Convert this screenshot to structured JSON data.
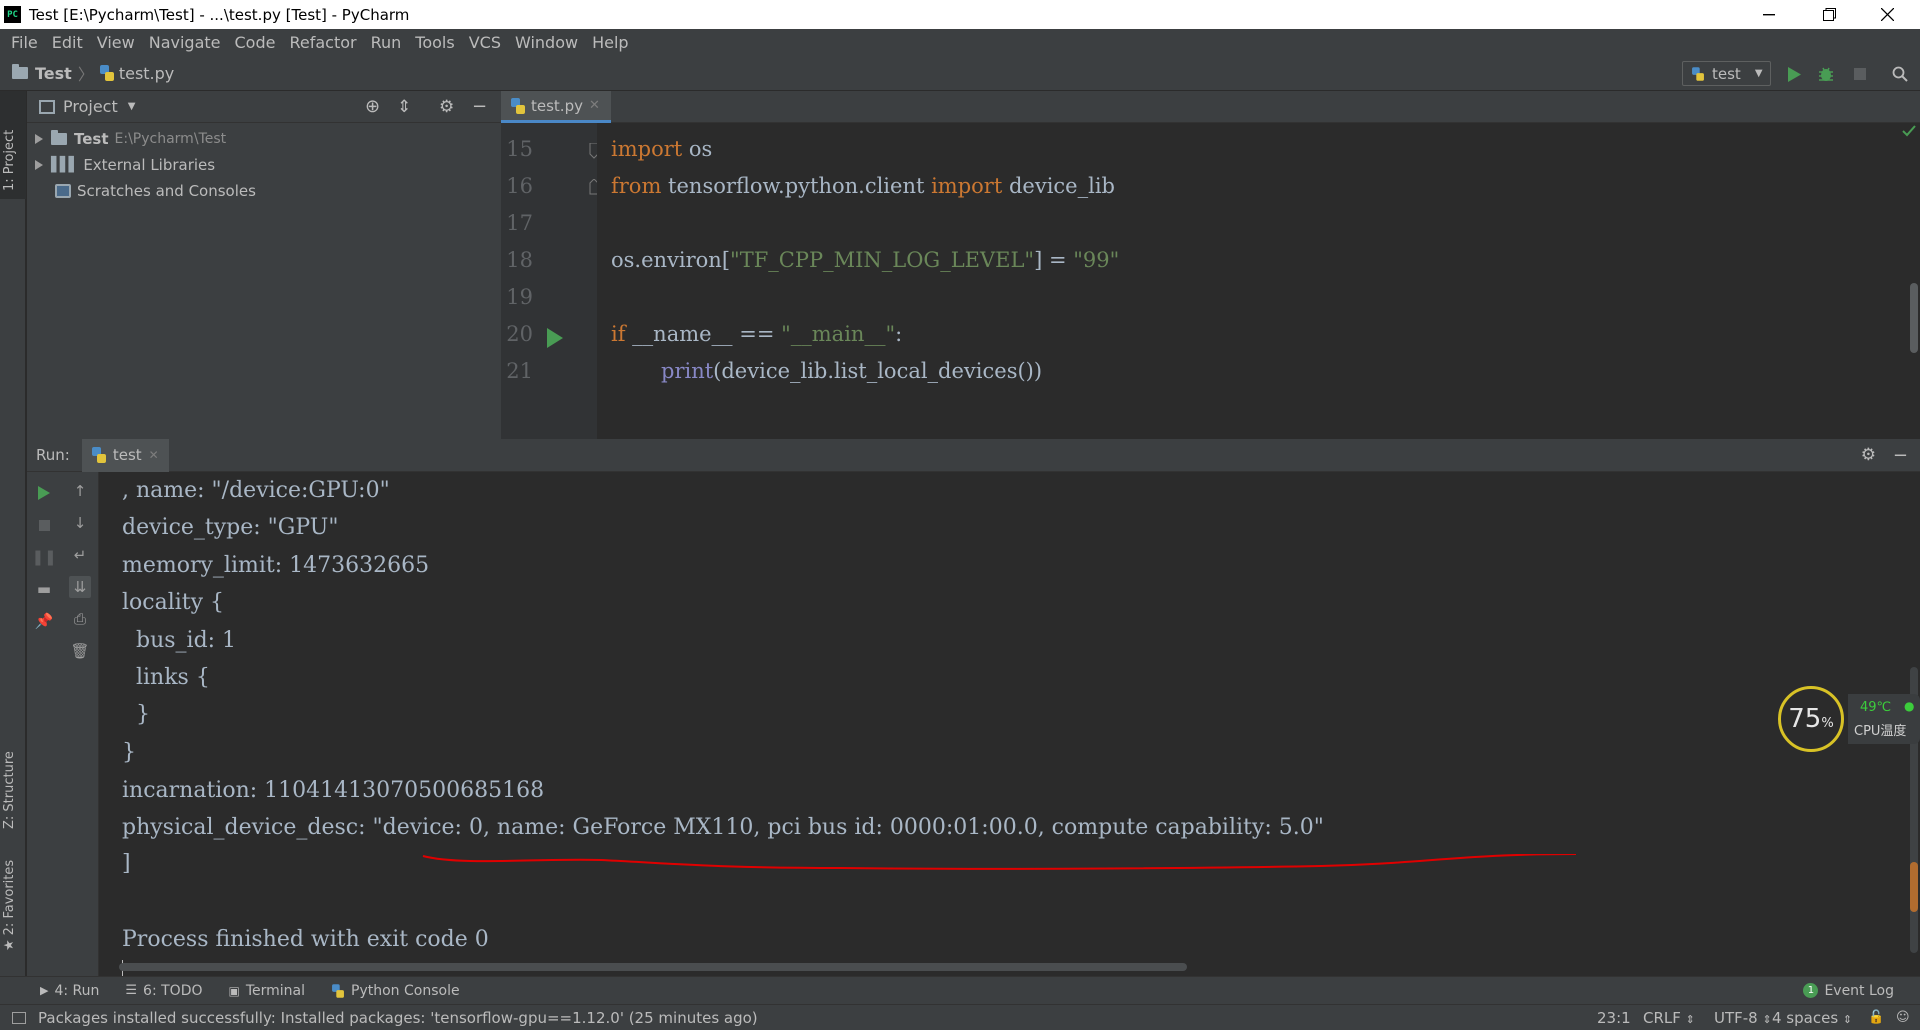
{
  "window": {
    "title": "Test [E:\\Pycharm\\Test] - ...\\test.py [Test] - PyCharm",
    "app_icon": "PC"
  },
  "menu": [
    "File",
    "Edit",
    "View",
    "Navigate",
    "Code",
    "Refactor",
    "Run",
    "Tools",
    "VCS",
    "Window",
    "Help"
  ],
  "breadcrumb": {
    "project": "Test",
    "file": "test.py"
  },
  "run_config": {
    "name": "test"
  },
  "left_strip": {
    "project_tab": "1: Project",
    "structure_tab": "Z: Structure",
    "favorites_tab": "2: Favorites"
  },
  "project_panel": {
    "title": "Project",
    "tree": [
      {
        "label": "Test",
        "path": "E:\\Pycharm\\Test"
      },
      {
        "label": "External Libraries"
      },
      {
        "label": "Scratches and Consoles"
      }
    ]
  },
  "editor": {
    "tab": "test.py",
    "lines": [
      {
        "n": "15"
      },
      {
        "n": "16"
      },
      {
        "n": "17"
      },
      {
        "n": "18"
      },
      {
        "n": "19"
      },
      {
        "n": "20"
      },
      {
        "n": "21"
      }
    ],
    "code": {
      "l15_kw": "import",
      "l15_rest": " os",
      "l16_kw1": "from",
      "l16_mid": " tensorflow.python.client ",
      "l16_kw2": "import",
      "l16_rest": " device_lib",
      "l18_a": "os.environ[",
      "l18_str": "\"TF_CPP_MIN_LOG_LEVEL\"",
      "l18_b": "] = ",
      "l18_str2": "\"99\"",
      "l20_kw": "if",
      "l20_a": " __name__ == ",
      "l20_str": "\"__main__\"",
      "l20_b": ":",
      "l21_fn": "print",
      "l21_rest": "(device_lib.list_local_devices())"
    }
  },
  "run_panel": {
    "label": "Run:",
    "tab": "test",
    "output": [
      ", name: \"/device:GPU:0\"",
      "device_type: \"GPU\"",
      "memory_limit: 1473632665",
      "locality {",
      "  bus_id: 1",
      "  links {",
      "  }",
      "}",
      "incarnation: 11041413070500685168",
      "physical_device_desc: \"device: 0, name: GeForce MX110, pci bus id: 0000:01:00.0, compute capability: 5.0\"",
      "]",
      "",
      "Process finished with exit code 0"
    ]
  },
  "cpu_widget": {
    "percent": "75",
    "percent_sign": "%",
    "temp": "49℃",
    "label": "CPU温度"
  },
  "bottom_tabs": {
    "run": "4: Run",
    "todo": "6: TODO",
    "terminal": "Terminal",
    "python_console": "Python Console",
    "event_log": "Event Log",
    "event_count": "1"
  },
  "status": {
    "message": "Packages installed successfully: Installed packages: 'tensorflow-gpu==1.12.0' (25 minutes ago)",
    "position": "23:1",
    "line_sep": "CRLF",
    "encoding": "UTF-8",
    "indent": "4 spaces"
  },
  "colors": {
    "keyword": "#cc7832",
    "string": "#6a8759",
    "builtin": "#8888c6",
    "run_green": "#499c54",
    "annotation_red": "#e00000"
  }
}
